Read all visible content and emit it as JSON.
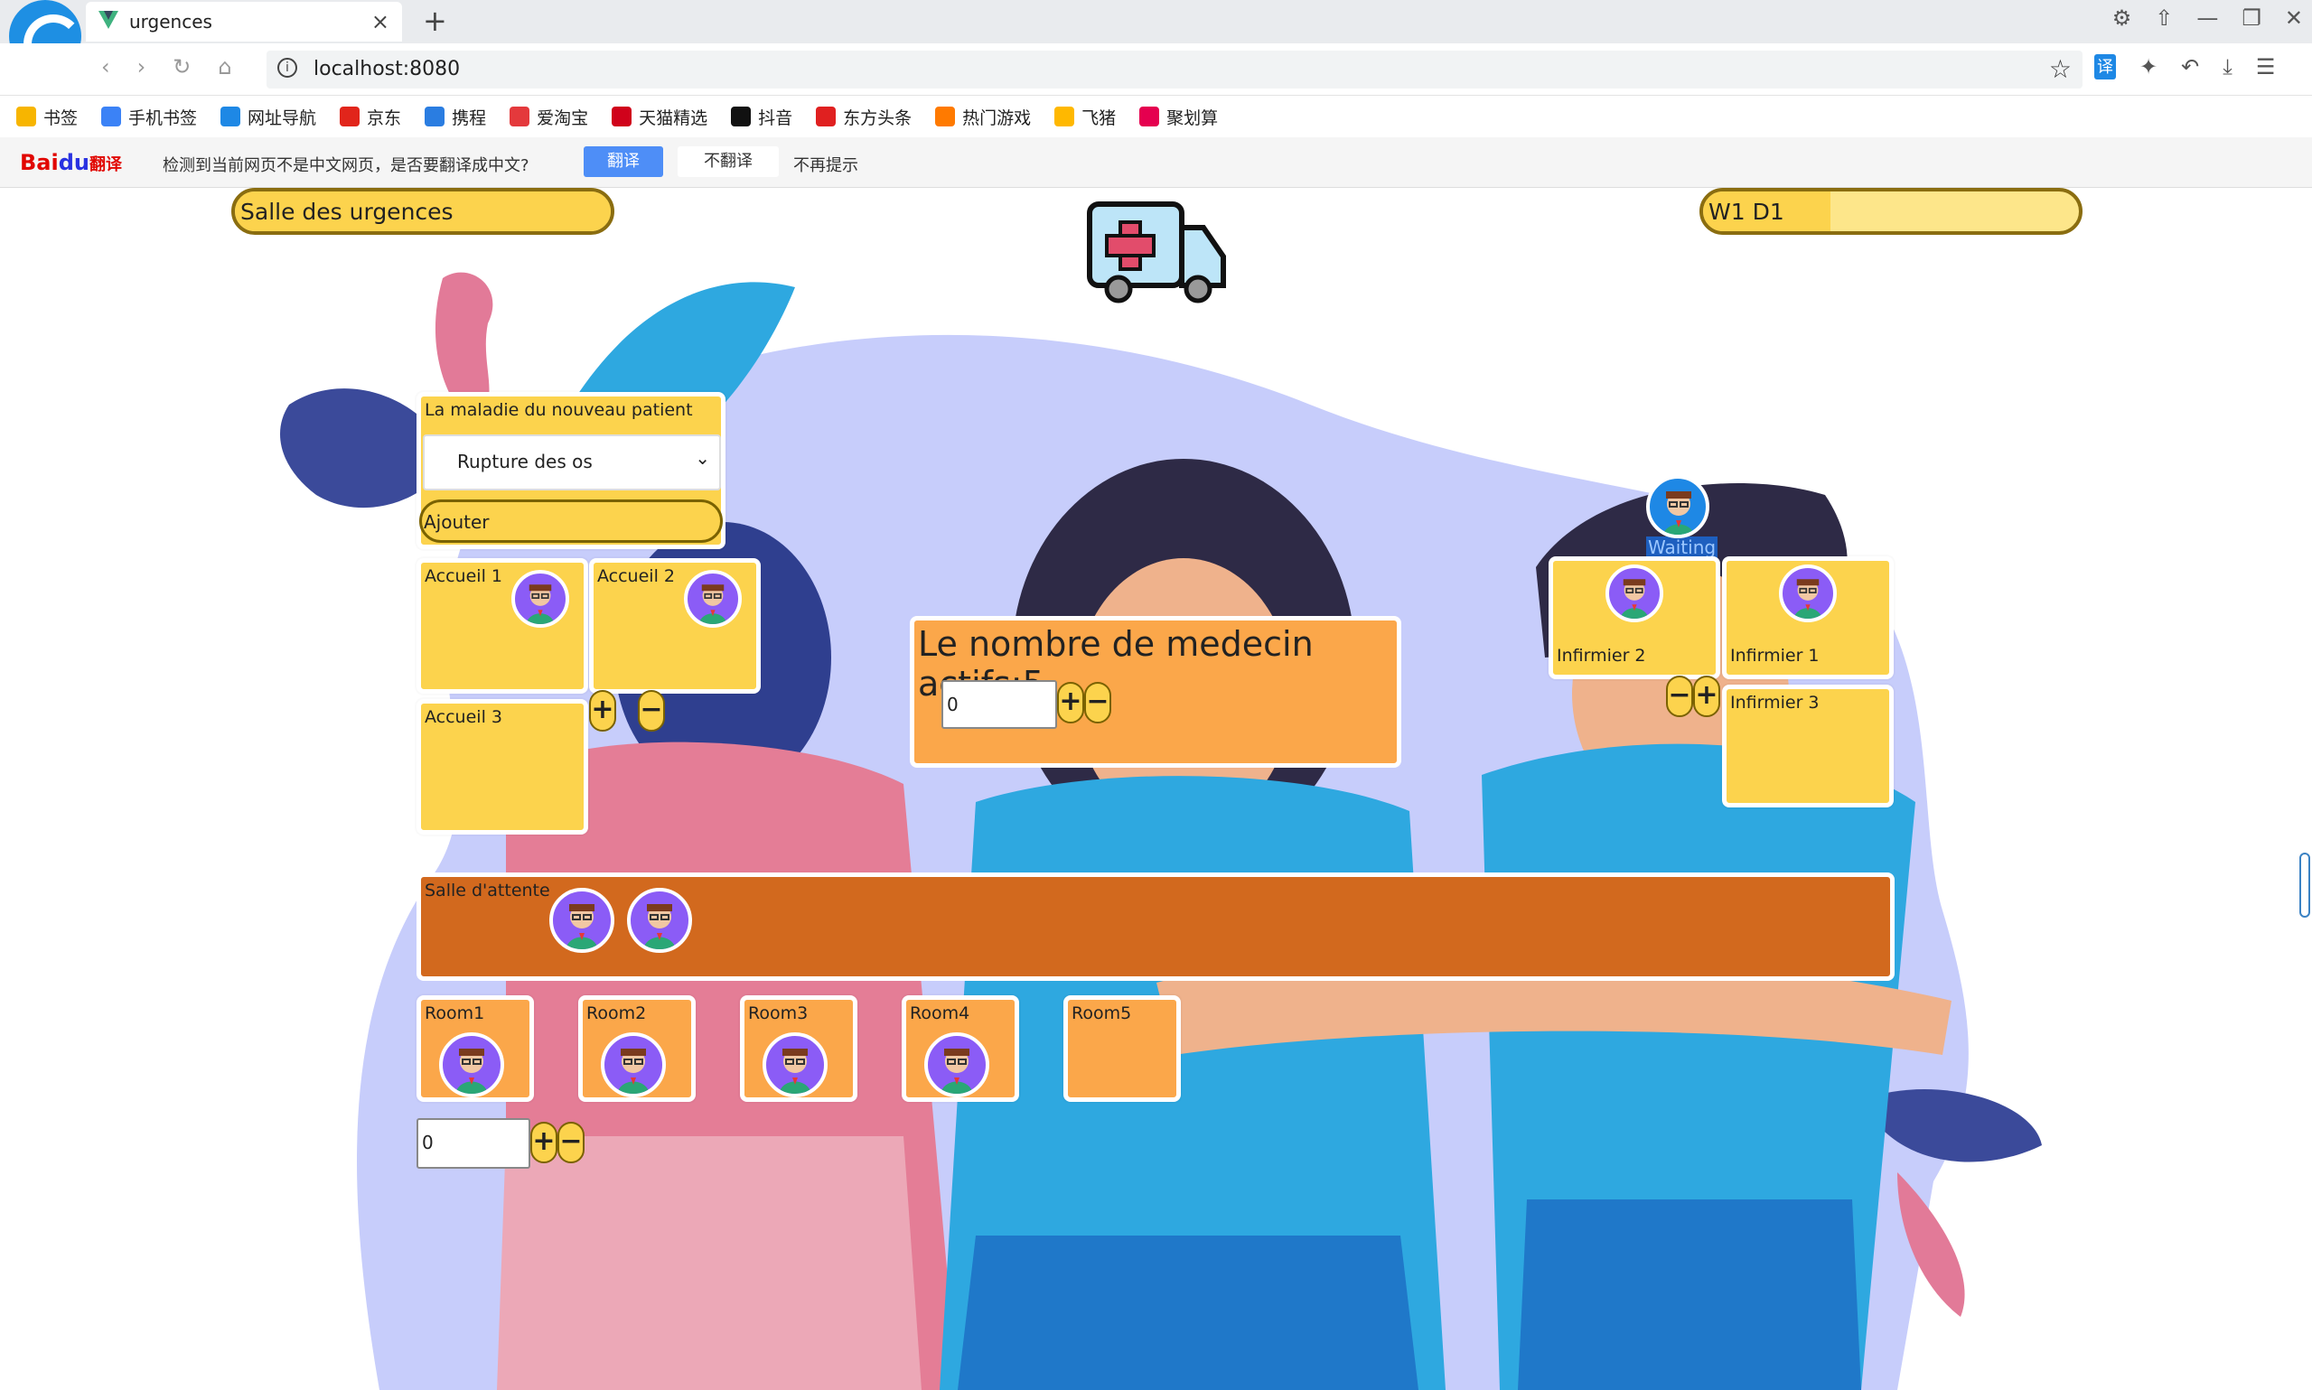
{
  "browser": {
    "tab_title": "urgences",
    "tab_close": "×",
    "new_tab": "+",
    "url": "localhost:8080",
    "info": "i",
    "star": "☆",
    "window_controls": [
      "⚙",
      "⇧",
      "—",
      "❐",
      "✕"
    ],
    "nav": [
      "‹",
      "›",
      "↻",
      "⌂"
    ],
    "extensions": [
      "译",
      "✦",
      "↶",
      "⤓",
      "☰"
    ]
  },
  "bookmarks": [
    {
      "label": "书签",
      "color": "#f7b500"
    },
    {
      "label": "手机书签",
      "color": "#3b82f6"
    },
    {
      "label": "网址导航",
      "color": "#1e88e5"
    },
    {
      "label": "京东",
      "color": "#e1251b"
    },
    {
      "label": "携程",
      "color": "#2a7de1"
    },
    {
      "label": "爱淘宝",
      "color": "#e4393c"
    },
    {
      "label": "天猫精选",
      "color": "#d0021b"
    },
    {
      "label": "抖音",
      "color": "#111111"
    },
    {
      "label": "东方头条",
      "color": "#e02020"
    },
    {
      "label": "热门游戏",
      "color": "#ff7a00"
    },
    {
      "label": "飞猪",
      "color": "#ffb800"
    },
    {
      "label": "聚划算",
      "color": "#e5004f"
    }
  ],
  "translate_bar": {
    "logo_a": "Bai",
    "logo_b": "du",
    "logo_c": "翻译",
    "message": "检测到当前网页不是中文网页，是否要翻译成中文?",
    "translate": "翻译",
    "no_translate": "不翻译",
    "never": "不再提示"
  },
  "header": {
    "title": "Salle des urgences",
    "week_day": "W1   D1",
    "progress": 0.34
  },
  "waiting_badge": "Waiting",
  "new_patient": {
    "title": "La maladie du nouveau patient",
    "selected": "Rupture des os",
    "add_button": "Ajouter"
  },
  "accueil": [
    "Accueil 1",
    "Accueil 2",
    "Accueil 3"
  ],
  "infirmier": [
    "Infirmier 2",
    "Infirmier 1",
    "Infirmier 3"
  ],
  "doctors": {
    "title": "Le nombre de medecin actifs:5",
    "input_value": "0"
  },
  "waiting_room": {
    "label": "Salle d'attente"
  },
  "rooms": [
    "Room1",
    "Room2",
    "Room3",
    "Room4",
    "Room5"
  ],
  "rooms_input_value": "0",
  "plus": "+",
  "minus": "−",
  "colors": {
    "yellow": "#fcd34d",
    "orange": "#fba74a",
    "waiting_room": "#d2691e",
    "background_blob": "#c7cdfb"
  }
}
